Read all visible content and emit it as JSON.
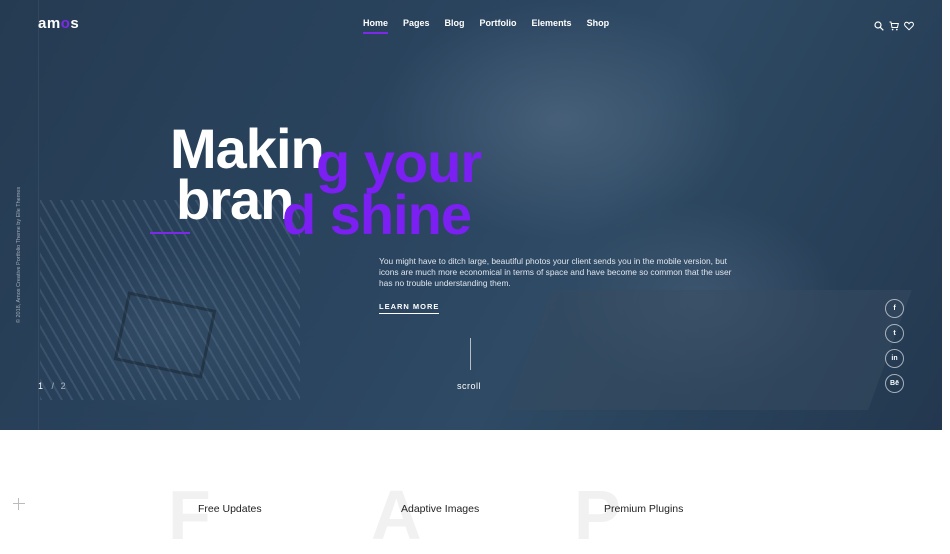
{
  "logo": {
    "before": "am",
    "dot": "o",
    "after": "s"
  },
  "nav": {
    "items": [
      "Home",
      "Pages",
      "Blog",
      "Portfolio",
      "Elements",
      "Shop"
    ]
  },
  "header_icons": [
    "search-icon",
    "cart-icon",
    "heart-icon"
  ],
  "copyright": "© 2018, Amos Creative Portfolio Theme by Elle Themes",
  "hero": {
    "line1_white": "Makin",
    "line1_purple": "g your",
    "line2_white": "bran",
    "line2_purple": "d shine",
    "description": "You might have to ditch large, beautiful photos your client sends you in the mobile version, but icons are much more economical in terms of space and have become so common that the user has no trouble understanding them.",
    "cta": "LEARN MORE",
    "scroll": "scroll",
    "slide_current": "1",
    "slide_sep": "/",
    "slide_total": "2"
  },
  "social": [
    {
      "icon": "facebook-icon",
      "glyph": "f"
    },
    {
      "icon": "twitter-icon",
      "glyph": "t"
    },
    {
      "icon": "linkedin-icon",
      "glyph": "in"
    },
    {
      "icon": "behance-icon",
      "glyph": "Bē"
    }
  ],
  "features": [
    {
      "letter": "F",
      "title": "Free Updates"
    },
    {
      "letter": "A",
      "title": "Adaptive Images"
    },
    {
      "letter": "P",
      "title": "Premium Plugins"
    }
  ],
  "colors": {
    "accent": "#7c2ae8",
    "hero_bg": "#2b4560",
    "purple_text": "#7b1ff2"
  }
}
